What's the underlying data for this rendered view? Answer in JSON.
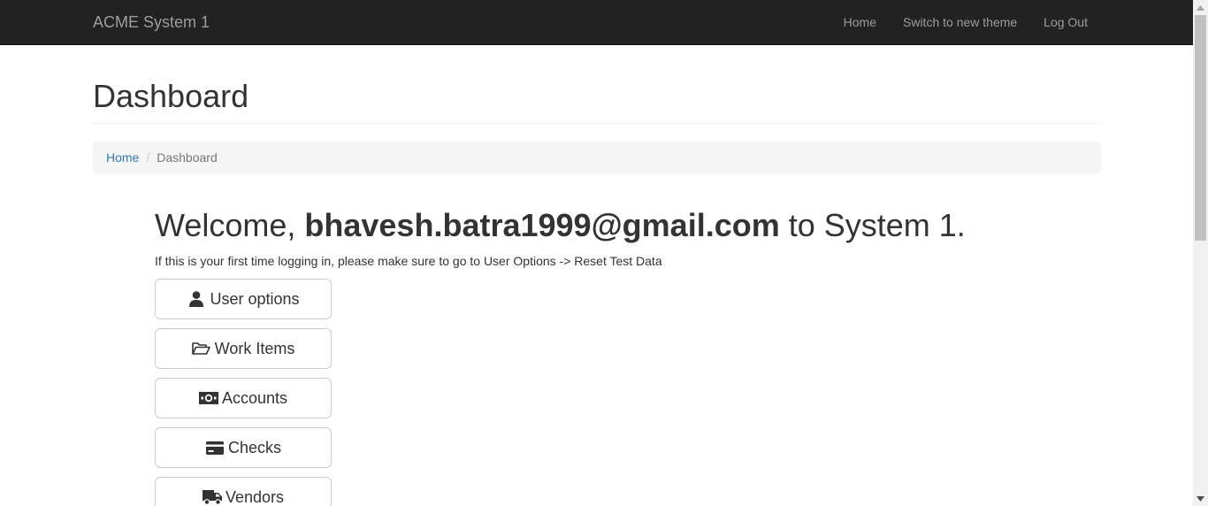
{
  "navbar": {
    "brand": "ACME System 1",
    "links": [
      "Home",
      "Switch to new theme",
      "Log Out"
    ]
  },
  "page": {
    "title": "Dashboard"
  },
  "breadcrumb": {
    "home": "Home",
    "separator": "/",
    "current": "Dashboard"
  },
  "welcome": {
    "prefix": "Welcome, ",
    "user": "bhavesh.batra1999@gmail.com",
    "suffix": " to System 1.",
    "note": "If this is your first time logging in, please make sure to go to User Options -> Reset Test Data"
  },
  "buttons": [
    {
      "label": "User options",
      "icon": "user-icon"
    },
    {
      "label": "Work Items",
      "icon": "folder-open-icon"
    },
    {
      "label": "Accounts",
      "icon": "money-icon"
    },
    {
      "label": "Checks",
      "icon": "credit-card-icon"
    },
    {
      "label": "Vendors",
      "icon": "truck-icon"
    }
  ],
  "colors": {
    "navbar_bg": "#222222",
    "nav_text": "#9d9d9d",
    "link": "#337ab7",
    "breadcrumb_bg": "#f5f5f5",
    "button_border": "#cccccc"
  }
}
